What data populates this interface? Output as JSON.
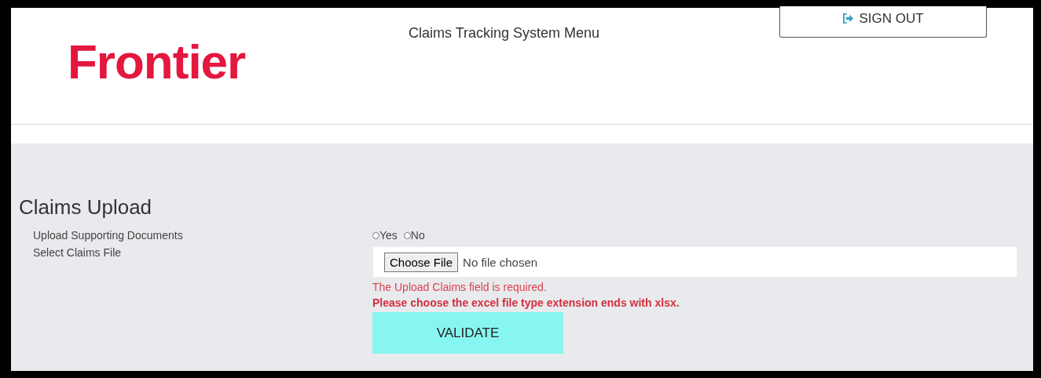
{
  "header": {
    "logo": "Frontier",
    "title": "Claims Tracking System Menu",
    "sign_out": "SIGN OUT"
  },
  "section": {
    "title": "Claims Upload",
    "supporting_documents": {
      "label": "Upload Supporting Documents",
      "options": [
        {
          "label": "Yes",
          "selected": false
        },
        {
          "label": "No",
          "selected": false
        }
      ]
    },
    "claims_file": {
      "label": "Select Claims File",
      "button": "Choose File",
      "status": "No file chosen"
    },
    "errors": [
      {
        "text": "The Upload Claims field is required.",
        "kind": "plain"
      },
      {
        "text": "Please choose the excel file type extension ends with xlsx.",
        "kind": "strong"
      }
    ],
    "validate": "VALIDATE"
  }
}
